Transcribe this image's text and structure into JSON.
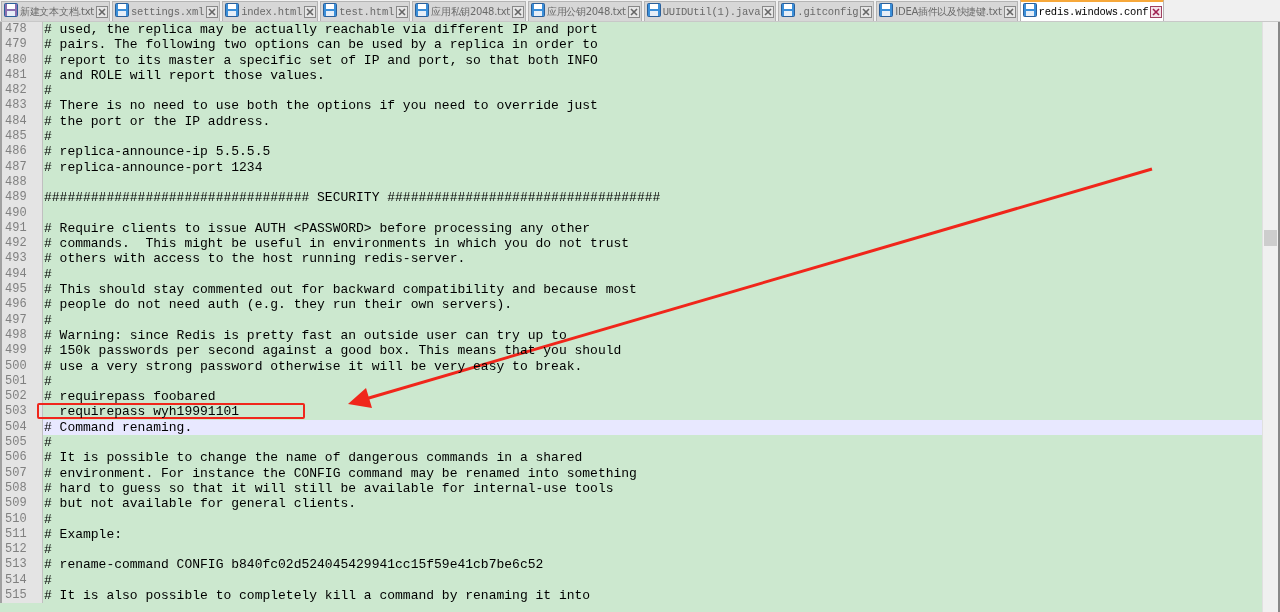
{
  "tabs": [
    {
      "label": "新建文本文档.txt",
      "selected": false,
      "unsaved": true
    },
    {
      "label": "settings.xml",
      "selected": false,
      "unsaved": false
    },
    {
      "label": "index.html",
      "selected": false,
      "unsaved": false
    },
    {
      "label": "test.html",
      "selected": false,
      "unsaved": false
    },
    {
      "label": "应用私钥2048.txt",
      "selected": false,
      "unsaved": false
    },
    {
      "label": "应用公钥2048.txt",
      "selected": false,
      "unsaved": false
    },
    {
      "label": "UUIDUtil(1).java",
      "selected": false,
      "unsaved": false
    },
    {
      "label": ".gitconfig",
      "selected": false,
      "unsaved": false
    },
    {
      "label": "IDEA插件以及快捷键.txt",
      "selected": false,
      "unsaved": false
    },
    {
      "label": "redis.windows.conf",
      "selected": true,
      "unsaved": false
    }
  ],
  "editor": {
    "lines": [
      {
        "number": "478",
        "text": "# used, the replica may be actually reachable via different IP and port",
        "current": false,
        "marked": false
      },
      {
        "number": "479",
        "text": "# pairs. The following two options can be used by a replica in order to",
        "current": false,
        "marked": false
      },
      {
        "number": "480",
        "text": "# report to its master a specific set of IP and port, so that both INFO",
        "current": false,
        "marked": false
      },
      {
        "number": "481",
        "text": "# and ROLE will report those values.",
        "current": false,
        "marked": false
      },
      {
        "number": "482",
        "text": "#",
        "current": false,
        "marked": false
      },
      {
        "number": "483",
        "text": "# There is no need to use both the options if you need to override just",
        "current": false,
        "marked": false
      },
      {
        "number": "484",
        "text": "# the port or the IP address.",
        "current": false,
        "marked": false
      },
      {
        "number": "485",
        "text": "#",
        "current": false,
        "marked": false
      },
      {
        "number": "486",
        "text": "# replica-announce-ip 5.5.5.5",
        "current": false,
        "marked": false
      },
      {
        "number": "487",
        "text": "# replica-announce-port 1234",
        "current": false,
        "marked": false
      },
      {
        "number": "488",
        "current": false,
        "marked": false
      },
      {
        "number": "489",
        "text": "################################## SECURITY ###################################",
        "current": false,
        "marked": false
      },
      {
        "number": "490",
        "current": false,
        "marked": false
      },
      {
        "number": "491",
        "text": "# Require clients to issue AUTH <PASSWORD> before processing any other",
        "current": false,
        "marked": false
      },
      {
        "number": "492",
        "text": "# commands.  This might be useful in environments in which you do not trust",
        "current": false,
        "marked": false
      },
      {
        "number": "493",
        "text": "# others with access to the host running redis-server.",
        "current": false,
        "marked": false
      },
      {
        "number": "494",
        "text": "#",
        "current": false,
        "marked": false
      },
      {
        "number": "495",
        "text": "# This should stay commented out for backward compatibility and because most",
        "current": false,
        "marked": false
      },
      {
        "number": "496",
        "text": "# people do not need auth (e.g. they run their own servers).",
        "current": false,
        "marked": false
      },
      {
        "number": "497",
        "text": "#",
        "current": false,
        "marked": false
      },
      {
        "number": "498",
        "text": "# Warning: since Redis is pretty fast an outside user can try up to",
        "current": false,
        "marked": false
      },
      {
        "number": "499",
        "text": "# 150k passwords per second against a good box. This means that you should",
        "current": false,
        "marked": false
      },
      {
        "number": "500",
        "text": "# use a very strong password otherwise it will be very easy to break.",
        "current": false,
        "marked": false
      },
      {
        "number": "501",
        "text": "#",
        "current": false,
        "marked": false
      },
      {
        "number": "502",
        "text": "# requirepass foobared",
        "current": false,
        "marked": false
      },
      {
        "number": "503",
        "text": "  requirepass wyh19991101",
        "current": false,
        "marked": true
      },
      {
        "number": "504",
        "text": "# Command renaming.",
        "current": true,
        "marked": false
      },
      {
        "number": "505",
        "text": "#",
        "current": false,
        "marked": false
      },
      {
        "number": "506",
        "text": "# It is possible to change the name of dangerous commands in a shared",
        "current": false,
        "marked": false
      },
      {
        "number": "507",
        "text": "# environment. For instance the CONFIG command may be renamed into something",
        "current": false,
        "marked": false
      },
      {
        "number": "508",
        "text": "# hard to guess so that it will still be available for internal-use tools",
        "current": false,
        "marked": false
      },
      {
        "number": "509",
        "text": "# but not available for general clients.",
        "current": false,
        "marked": false
      },
      {
        "number": "510",
        "text": "#",
        "current": false,
        "marked": false
      },
      {
        "number": "511",
        "text": "# Example:",
        "current": false,
        "marked": false
      },
      {
        "number": "512",
        "text": "#",
        "current": false,
        "marked": false
      },
      {
        "number": "513",
        "text": "# rename-command CONFIG b840fc02d524045429941cc15f59e41cb7be6c52",
        "current": false,
        "marked": false
      },
      {
        "number": "514",
        "text": "#",
        "current": false,
        "marked": false
      },
      {
        "number": "515",
        "text": "# It is also possible to completely kill a command by renaming it into",
        "current": false,
        "marked": false
      }
    ]
  }
}
